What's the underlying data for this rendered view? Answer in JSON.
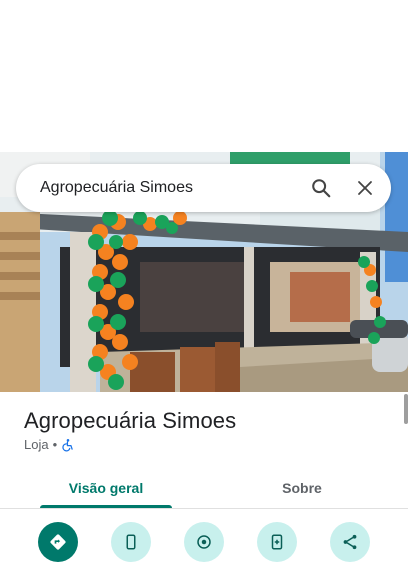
{
  "search": {
    "query": "Agropecuária Simoes"
  },
  "place": {
    "name": "Agropecuária Simoes",
    "category": "Loja",
    "separator": "•"
  },
  "tabs": [
    {
      "label": "Visão geral",
      "selected": true
    },
    {
      "label": "Sobre",
      "selected": false
    }
  ],
  "actions": [
    {
      "icon": "directions-icon",
      "primary": true
    },
    {
      "icon": "phone-icon",
      "primary": false
    },
    {
      "icon": "location-icon",
      "primary": false
    },
    {
      "icon": "save-icon",
      "primary": false
    },
    {
      "icon": "share-icon",
      "primary": false
    }
  ],
  "colors": {
    "accent": "#00796b",
    "action_bg": "#c8f0ed",
    "balloon_orange": "#f58220",
    "balloon_green": "#1aa35a"
  }
}
